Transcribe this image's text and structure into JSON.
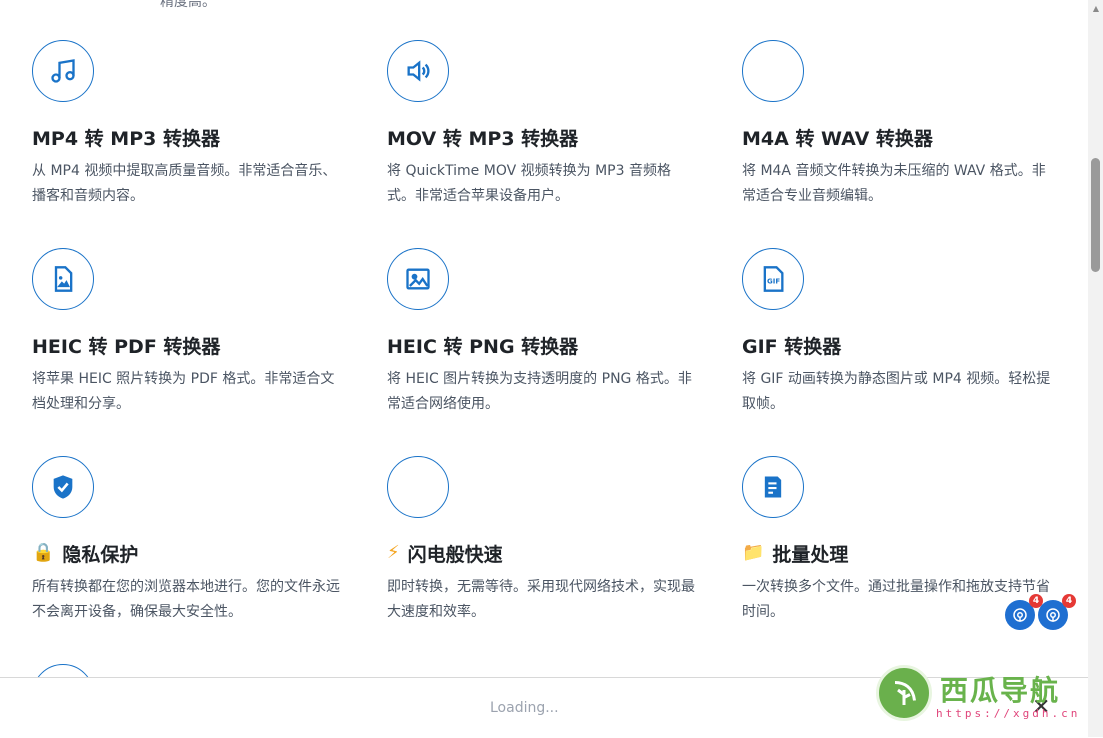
{
  "top_cut_text": "精度高。",
  "features": [
    {
      "icon": "music-note-icon",
      "emoji": "",
      "title": "MP4 转 MP3 转换器",
      "desc": "从 MP4 视频中提取高质量音频。非常适合音乐、播客和音频内容。"
    },
    {
      "icon": "speaker-icon",
      "emoji": "",
      "title": "MOV 转 MP3 转换器",
      "desc": "将 QuickTime MOV 视频转换为 MP3 音频格式。非常适合苹果设备用户。"
    },
    {
      "icon": "blank-icon",
      "emoji": "",
      "title": "M4A 转 WAV 转换器",
      "desc": "将 M4A 音频文件转换为未压缩的 WAV 格式。非常适合专业音频编辑。"
    },
    {
      "icon": "image-file-icon",
      "emoji": "",
      "title": "HEIC 转 PDF 转换器",
      "desc": "将苹果 HEIC 照片转换为 PDF 格式。非常适合文档处理和分享。"
    },
    {
      "icon": "image-icon",
      "emoji": "",
      "title": "HEIC 转 PNG 转换器",
      "desc": "将 HEIC 图片转换为支持透明度的 PNG 格式。非常适合网络使用。"
    },
    {
      "icon": "gif-file-icon",
      "emoji": "",
      "title": "GIF 转换器",
      "desc": "将 GIF 动画转换为静态图片或 MP4 视频。轻松提取帧。"
    },
    {
      "icon": "shield-check-icon",
      "emoji": "🔒",
      "title": "隐私保护",
      "desc": "所有转换都在您的浏览器本地进行。您的文件永远不会离开设备，确保最大安全性。"
    },
    {
      "icon": "blank-icon",
      "emoji": "⚡",
      "title": "闪电般快速",
      "desc": "即时转换，无需等待。采用现代网络技术，实现最大速度和效率。"
    },
    {
      "icon": "document-icon",
      "emoji": "📁",
      "title": "批量处理",
      "desc": "一次转换多个文件。通过批量操作和拖放支持节省时间。"
    }
  ],
  "bottom_bar": {
    "loading_text": "Loading...",
    "close_label": "✕"
  },
  "watermark": {
    "name": "西瓜导航",
    "url": "https://xgdh.cn"
  },
  "float_buttons": [
    {
      "badge": "4"
    },
    {
      "badge": "4"
    }
  ],
  "colors": {
    "accent": "#1a73c8",
    "watermark_green": "#69b34c",
    "watermark_pink": "#e0457b"
  }
}
